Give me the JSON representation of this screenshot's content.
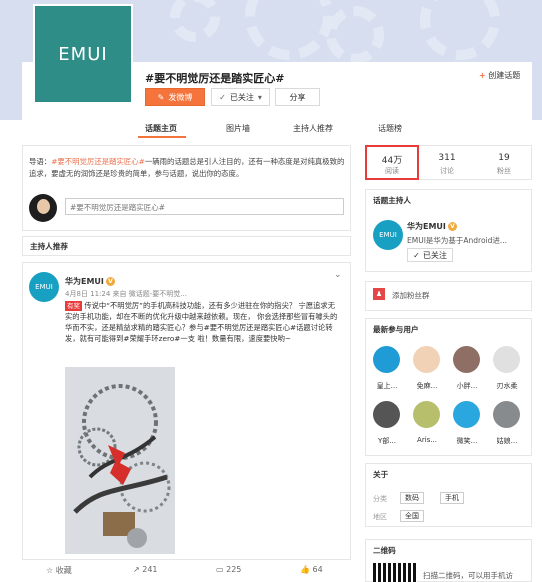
{
  "header": {
    "topic_title": "#要不明觉厉还是踏实匠心#",
    "logo_text": "EMUI",
    "create_topic": "创建话题",
    "buttons": {
      "post": "发微博",
      "following": "已关注",
      "share": "分享"
    }
  },
  "tabs": [
    "话题主页",
    "图片墙",
    "主持人推荐",
    "话题榜"
  ],
  "intro": {
    "label": "导语：",
    "topic": "#要不明觉厉还是踏实匠心#",
    "text": "一辆雨的话题总是引人注目的，还有一种态度是对纯真极致的追求，要虚无的润饰还是珍贵的简单，参与话题，说出你的态度。"
  },
  "compose": {
    "placeholder": "#要不明觉厉还是踏实匠心#"
  },
  "host_recommend": "主持人推荐",
  "post": {
    "author": "华为EMUI",
    "meta": "4月8日 11:24 来自 微话题-要不明觉...",
    "icon_text": "EMUI",
    "tag": "有奖",
    "body_1": "传说中“不明觉厉”的手机高科技功能，还有多少进驻在你的指尖？",
    "body_2": "宁愿追求无实的手机功能，却在不断的优化升级中越来越依赖。现在，",
    "body_3": "你会选择那些冒有噱头的华而不实，还是精益求精的踏实匠心？参与#要不明觉厉还是踏实匠心#话题讨论转发，就有可能得到#荣耀手环zero#一支",
    "body_4": "啦！数量有限，速度要快哟~",
    "highlight_topic": "#要不明觉厉还是踏实匠心#",
    "highlight_product": "#荣耀手环zero#",
    "actions": {
      "favorite": "收藏",
      "repost": "241",
      "comment": "225",
      "like": "64"
    }
  },
  "stats": [
    {
      "value": "44万",
      "label": "阅读"
    },
    {
      "value": "311",
      "label": "讨论"
    },
    {
      "value": "19",
      "label": "粉丝"
    }
  ],
  "host": {
    "title": "话题主持人",
    "name": "华为EMUI",
    "desc": "EMUI是华为基于Android进...",
    "icon_text": "EMUI",
    "follow": "已关注"
  },
  "fans_service": "添加粉丝群",
  "recent_users": {
    "title": "最新参与用户",
    "users": [
      "皇上...",
      "免麻...",
      "小胖...",
      "刃水柔",
      "Y部...",
      "Aris...",
      "微笑...",
      "姑娘..."
    ]
  },
  "about": {
    "title": "关于",
    "category_label": "分类",
    "category_tags": [
      "数码",
      "手机"
    ],
    "region_label": "地区",
    "region_tags": [
      "全国"
    ]
  },
  "qrcode": {
    "title": "二维码",
    "text": "扫描二维码，可以用手机访"
  },
  "colors": {
    "accent": "#f4743b",
    "teal": "#2e8d87",
    "highlight": "#eb7350",
    "stats_border": "#e83b3b"
  }
}
